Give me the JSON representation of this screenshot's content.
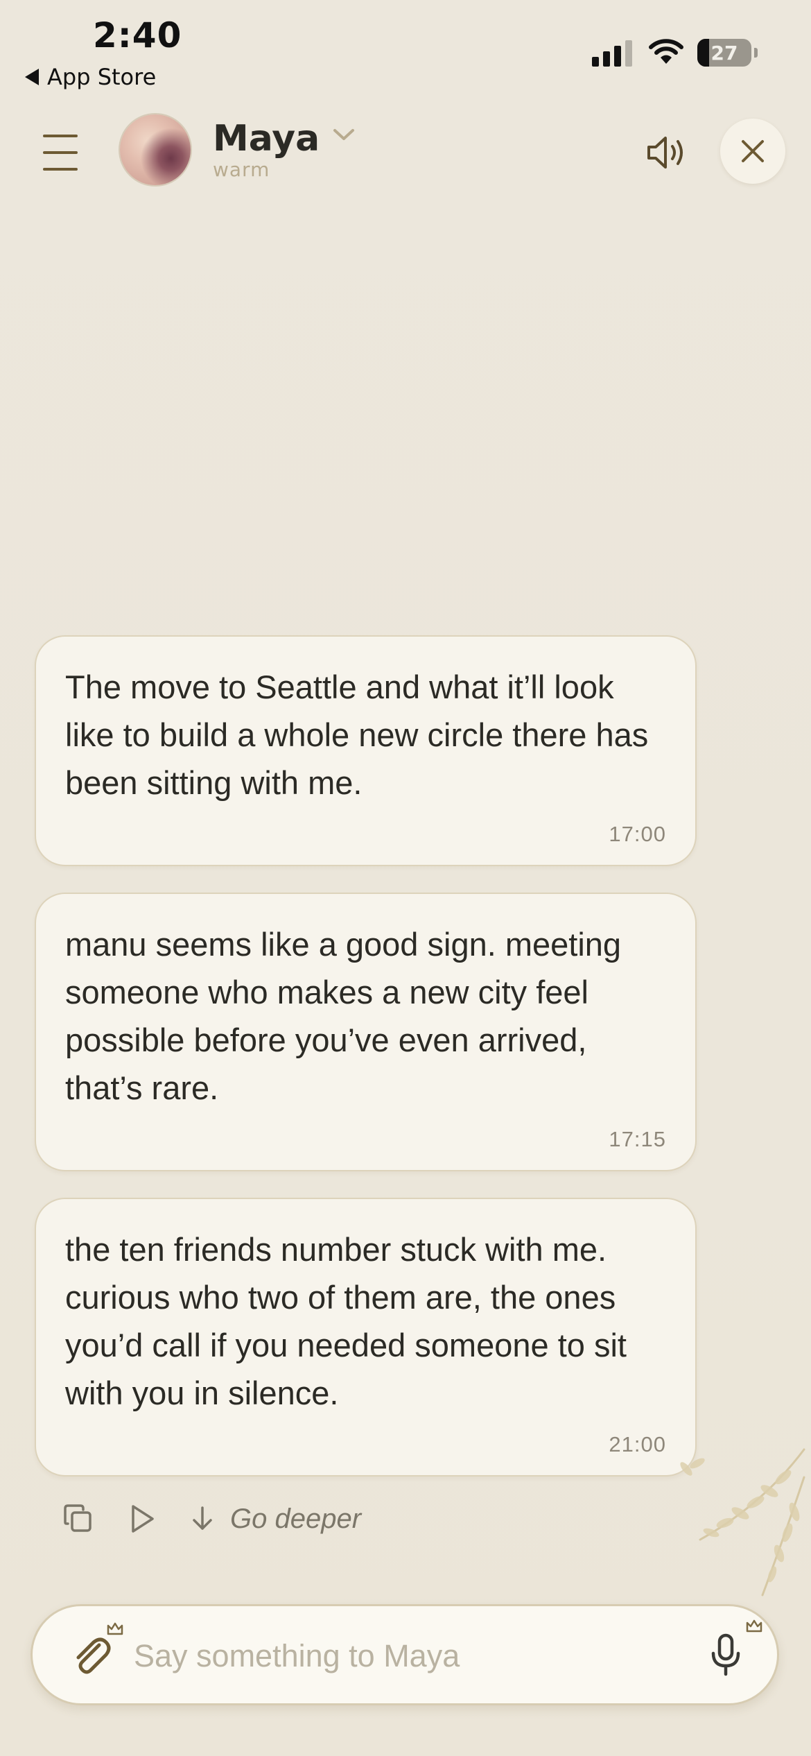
{
  "status_bar": {
    "time": "2:40",
    "back_label": "App Store",
    "battery_level": "27",
    "signal_bars": 3,
    "signal_max": 4
  },
  "header": {
    "menu_icon": "hamburger-menu-icon",
    "contact_name": "Maya",
    "contact_mood": "warm",
    "speaker_icon": "speaker-volume-icon",
    "close_icon": "close-x-icon"
  },
  "messages": [
    {
      "text": "The move to Seattle and what it’ll look like to build a whole new circle there has been sitting with me.",
      "time": "17:00"
    },
    {
      "text": "manu seems like a good sign. meeting someone who makes a new city feel possible before you’ve even arrived, that’s rare.",
      "time": "17:15"
    },
    {
      "text": "the ten friends number stuck with me. curious who two of them are, the ones you’d call if you needed someone to sit with you in silence.",
      "time": "21:00"
    }
  ],
  "actions": {
    "copy_icon": "copy-icon",
    "play_icon": "play-icon",
    "go_deeper_icon": "arrow-down-icon",
    "go_deeper_label": "Go deeper"
  },
  "composer": {
    "placeholder": "Say something to Maya",
    "value": "",
    "attach_icon": "paperclip-icon",
    "mic_icon": "microphone-icon",
    "premium_icon": "crown-icon"
  },
  "colors": {
    "background": "#ece7dc",
    "bubble": "#f7f4ec",
    "accent": "#6d5a33",
    "muted_text": "#8e877a"
  }
}
